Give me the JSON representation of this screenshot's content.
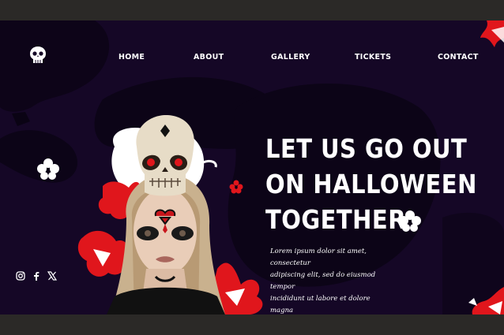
{
  "nav": {
    "logo_icon": "skull-icon",
    "items": [
      {
        "label": "HOME"
      },
      {
        "label": "ABOUT"
      },
      {
        "label": "GALLERY"
      },
      {
        "label": "TICKETS"
      },
      {
        "label": "CONTACT"
      }
    ]
  },
  "hero": {
    "headline_lines": [
      "LET US GO OUT",
      "ON HALLOWEEN",
      "TOGETHER"
    ],
    "body_lines": [
      "Lorem ipsum dolor sit amet, consectetur",
      "adipiscing elit, sed do eiusmod tempor",
      "incididunt ut labore et dolore magna"
    ],
    "image_alt_icon": "woman-with-skull-icon"
  },
  "social": [
    {
      "icon": "instagram-icon"
    },
    {
      "icon": "facebook-icon"
    },
    {
      "icon": "x-twitter-icon"
    }
  ],
  "colors": {
    "background": "#150726",
    "accent": "#e0161c",
    "frame": "#2b2927",
    "text": "#ffffff"
  }
}
